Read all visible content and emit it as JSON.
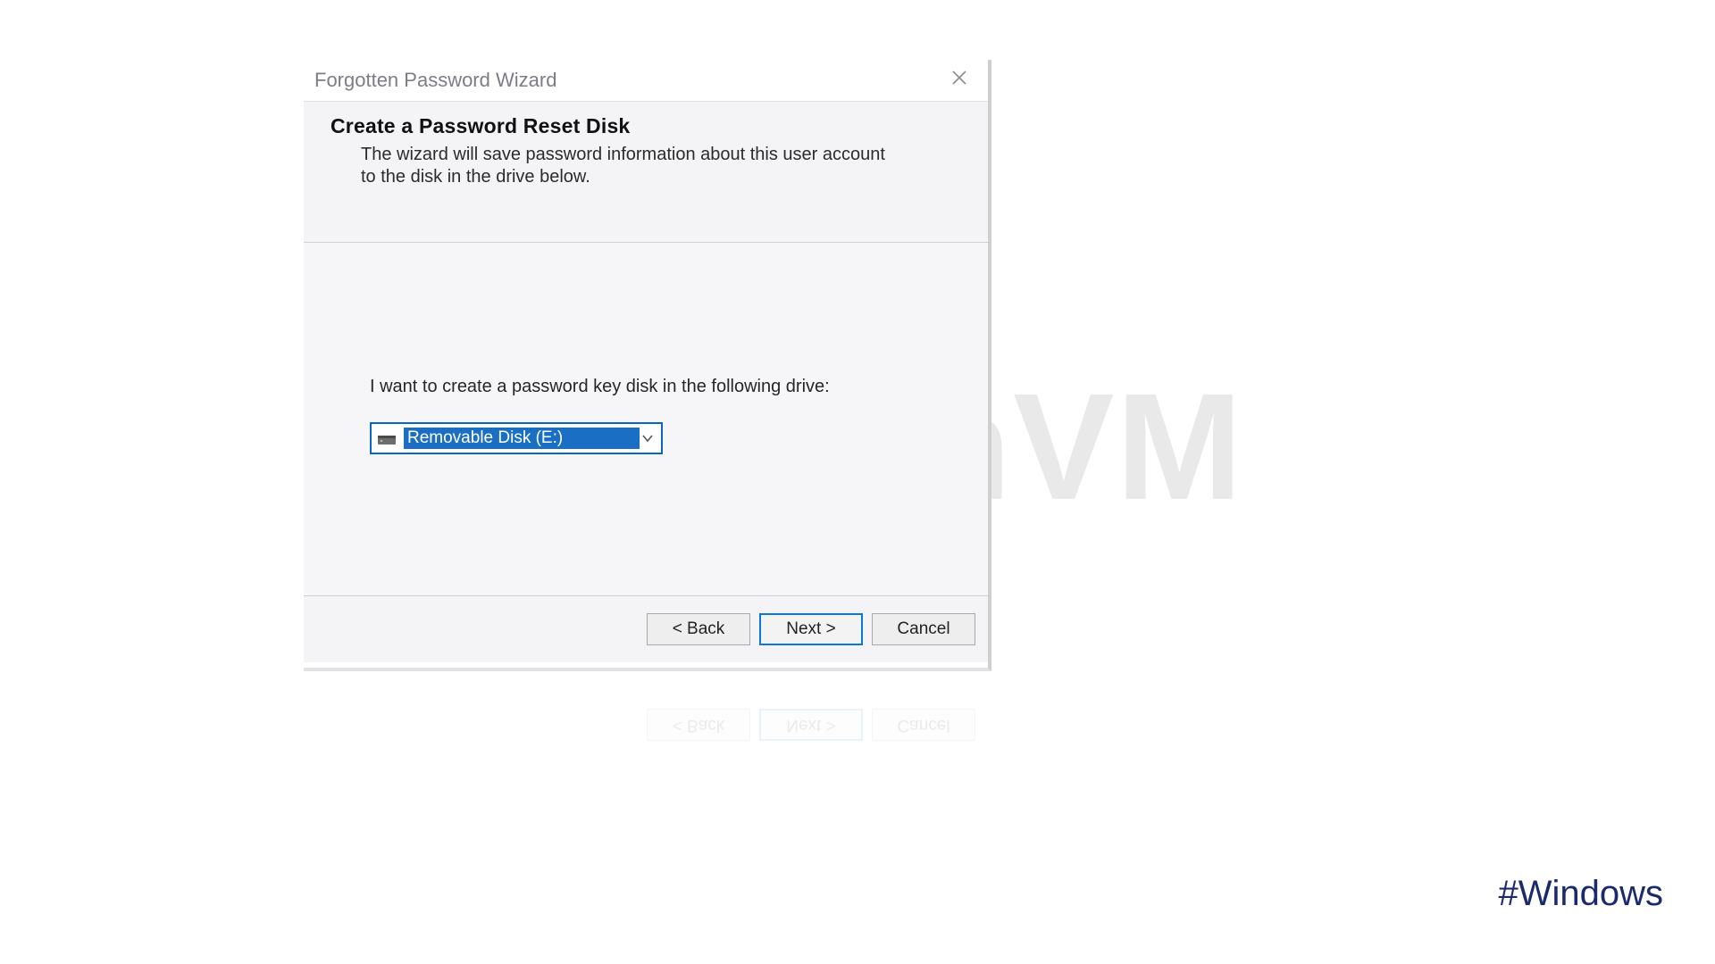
{
  "watermark": "NeuronVM",
  "hashtag": "#Windows",
  "dialog": {
    "title": "Forgotten Password Wizard",
    "header_title": "Create a Password Reset Disk",
    "header_sub": "The wizard will save password information about this user account to the disk in the drive below.",
    "prompt": "I want to create a password key disk in the following drive:",
    "drive_selected": "Removable Disk (E:)",
    "buttons": {
      "back": "< Back",
      "next": "Next >",
      "cancel": "Cancel"
    }
  },
  "icons": {
    "close": "close",
    "caret": "chevron-down",
    "drive": "removable-disk"
  },
  "colors": {
    "focus_border": "#0a66c2",
    "selection_bg": "#1a6fc4",
    "hashtag": "#1b2a6b"
  }
}
